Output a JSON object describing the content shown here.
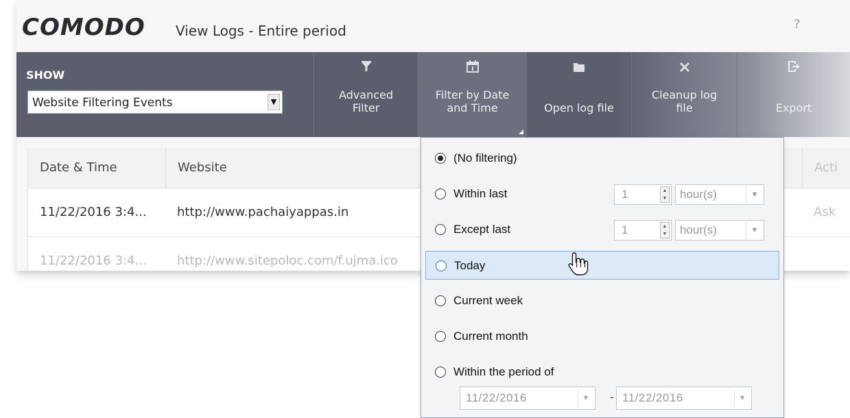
{
  "app": {
    "logo": "COMODO",
    "title": "View Logs - Entire period",
    "help": "?"
  },
  "toolbar": {
    "show_label": "SHOW",
    "show_value": "Website Filtering Events",
    "buttons": [
      {
        "label": "Advanced\nFilter",
        "icon": "funnel-icon"
      },
      {
        "label": "Filter by Date\nand Time",
        "icon": "calendar-icon"
      },
      {
        "label": "Open log file",
        "icon": "folder-icon"
      },
      {
        "label": "Cleanup log\nfile",
        "icon": "x-icon"
      },
      {
        "label": "Export",
        "icon": "export-icon"
      }
    ]
  },
  "table": {
    "columns": [
      "Date & Time",
      "Website",
      "Acti"
    ],
    "rows": [
      {
        "date": "11/22/2016 3:4...",
        "website": "http://www.pachaiyappas.in",
        "action": "Ask"
      },
      {
        "date": "11/22/2016 3:4...",
        "website": "http://www.sitepoloc.com/f.ujma.ico",
        "action": ""
      }
    ]
  },
  "dropdown": {
    "options": [
      {
        "label": "(No filtering)",
        "checked": true
      },
      {
        "label": "Within last",
        "checked": false
      },
      {
        "label": "Except last",
        "checked": false
      },
      {
        "label": "Today",
        "checked": false,
        "hover": true
      },
      {
        "label": "Current week",
        "checked": false
      },
      {
        "label": "Current month",
        "checked": false
      },
      {
        "label": "Within the period of",
        "checked": false
      }
    ],
    "within_last": {
      "count": "1",
      "unit": "hour(s)"
    },
    "except_last": {
      "count": "1",
      "unit": "hour(s)"
    },
    "period": {
      "from": "11/22/2016",
      "to": "11/22/2016",
      "separator": "-"
    }
  },
  "colors": {
    "toolbar": "#5b5e6c",
    "hover": "#dbe9f8",
    "hover_border": "#7daee8"
  }
}
